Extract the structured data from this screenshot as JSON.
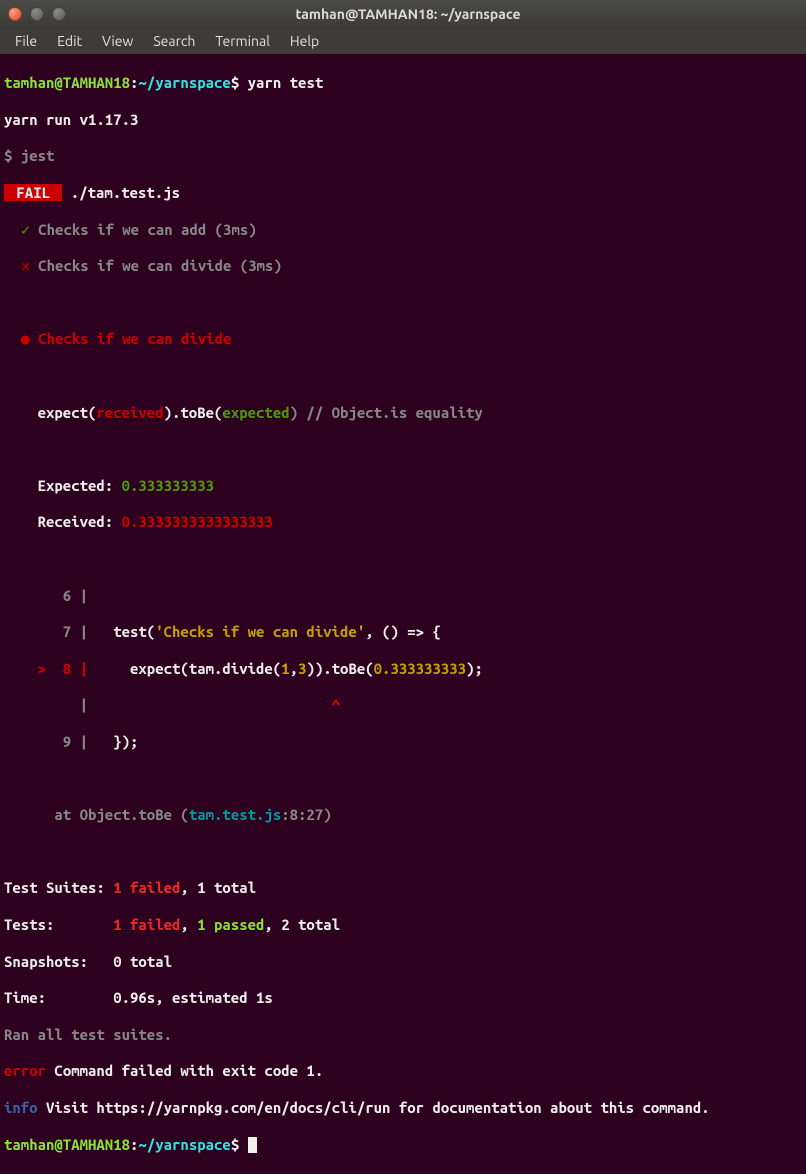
{
  "window": {
    "title": "tamhan@TAMHAN18: ~/yarnspace"
  },
  "menu": {
    "file": "File",
    "edit": "Edit",
    "view": "View",
    "search": "Search",
    "terminal": "Terminal",
    "help": "Help"
  },
  "prompt": {
    "userhost": "tamhan@TAMHAN18",
    "sep": ":",
    "path": "~/yarnspace",
    "dollar": "$"
  },
  "cmd": {
    "yarn_test": "yarn test"
  },
  "out": {
    "yarn_run": "yarn run v1.17.3",
    "jest_cmd": "$ jest",
    "fail_badge": " FAIL ",
    "fail_file": " ./tam.test.js",
    "pass_check": "✓",
    "pass_text": " Checks if we can add (3ms)",
    "fail_check": "✕",
    "fail_text": " Checks if we can divide (3ms)",
    "bullet": "●",
    "fail_title": " Checks if we can divide",
    "expect_line_1": "    expect(",
    "received_word": "received",
    "expect_line_2": ").toBe(",
    "expected_word": "expected",
    "expect_line_3": ") // Object.is equality",
    "expected_lbl": "    Expected: ",
    "expected_val": "0.333333333",
    "received_lbl": "    Received: ",
    "received_val": "0.3333333333333333",
    "ln6": "       6 |",
    "ln7_pre": "       7 | ",
    "ln7_code_a": "  test(",
    "ln7_str": "'Checks if we can divide'",
    "ln7_code_b": ", () => {",
    "ln8_marker": "    >  8 | ",
    "ln8_code_a": "    expect(tam.divide(",
    "ln8_num1": "1",
    "ln8_comma": ",",
    "ln8_num2": "3",
    "ln8_code_b": ")).toBe(",
    "ln8_num3": "0.333333333",
    "ln8_code_c": ");",
    "caret_line": "         |                             ",
    "caret": "^",
    "ln9_pre": "       9 | ",
    "ln9_code": "  });",
    "at_line_a": "      at Object.toBe (",
    "at_line_file": "tam.test.js",
    "at_line_b": ":8:27)",
    "suites_lbl": "Test Suites: ",
    "suites_fail": "1 failed",
    "suites_rest": ", 1 total",
    "tests_lbl": "Tests:       ",
    "tests_fail": "1 failed",
    "tests_mid": ", ",
    "tests_pass": "1 passed",
    "tests_rest": ", 2 total",
    "snap_lbl": "Snapshots:   ",
    "snap_val": "0 total",
    "time_lbl": "Time:        ",
    "time_val": "0.96s, estimated 1s",
    "ran": "Ran all test suites.",
    "error_word": "error",
    "error_rest": " Command failed with exit code 1.",
    "info_word": "info",
    "info_a": " Visit ",
    "info_url": "https://yarnpkg.com/en/docs/cli/run",
    "info_b": " for documentation about this command."
  }
}
